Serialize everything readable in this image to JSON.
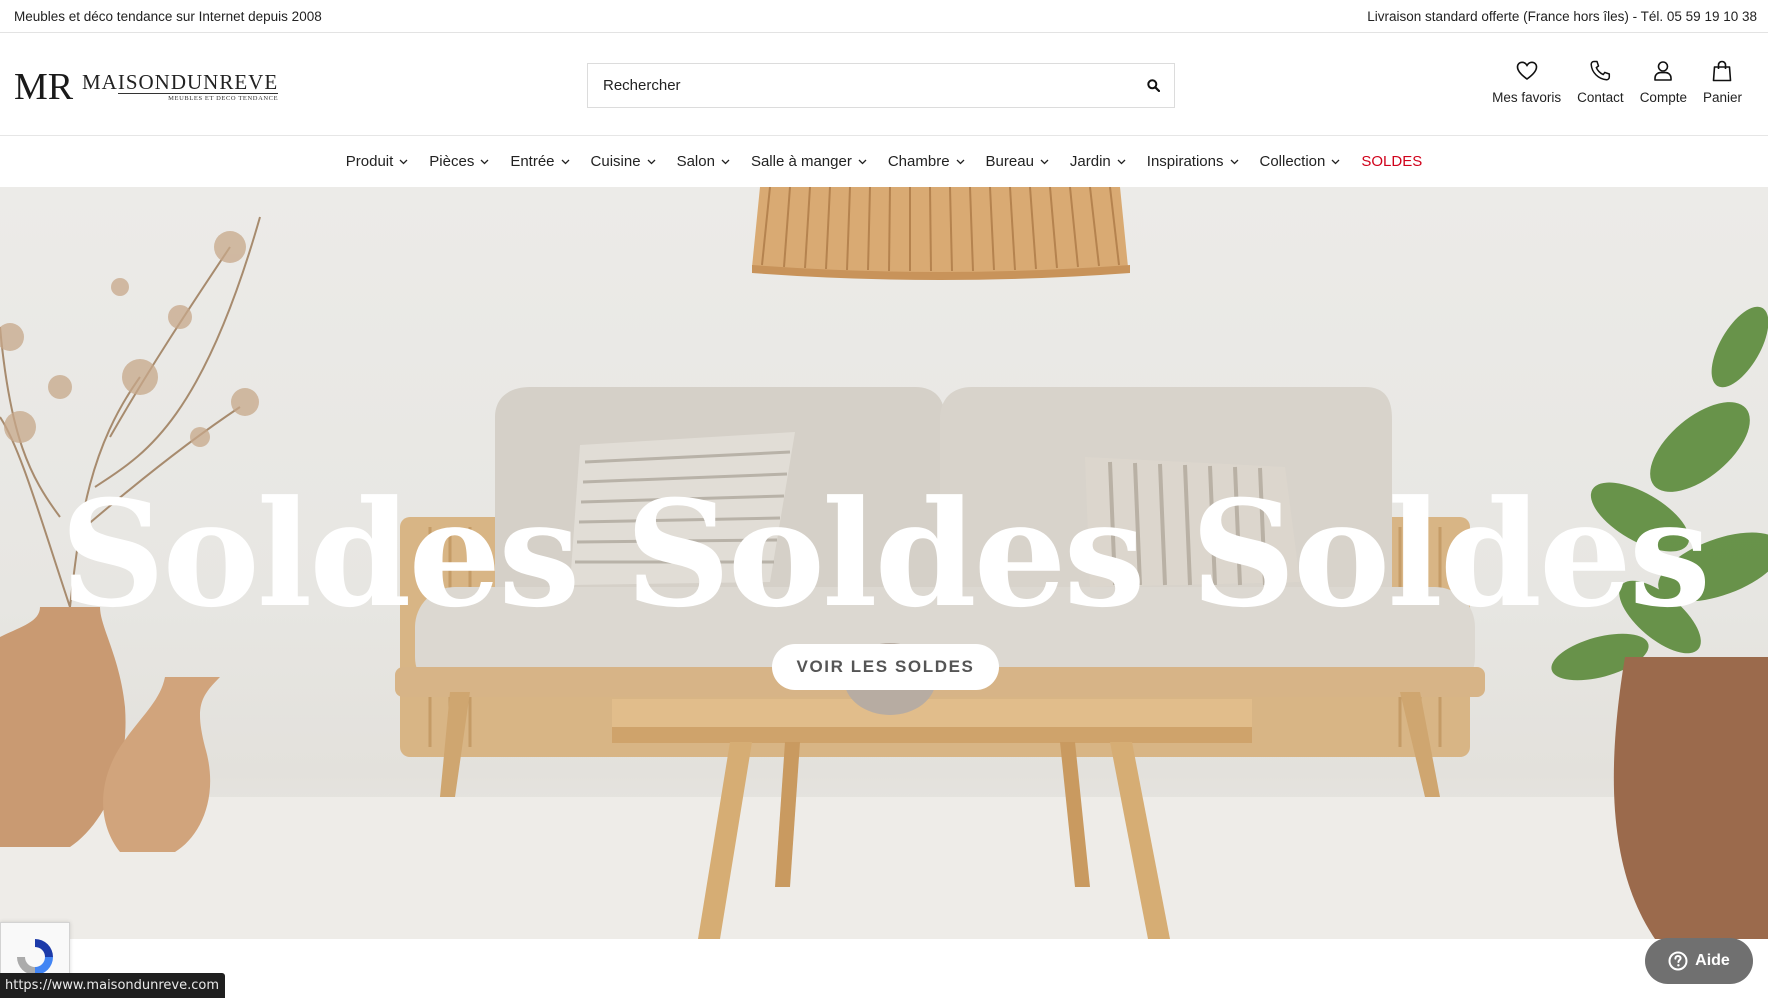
{
  "topbar": {
    "left_text": "Meubles et déco tendance sur Internet depuis 2008",
    "right_text": "Livraison standard offerte (France hors îles) - Tél. 05 59 19 10 38"
  },
  "logo": {
    "mark": "MR",
    "name": "MAISONDUNREVE",
    "tagline": "MEUBLES ET DECO TENDANCE"
  },
  "search": {
    "placeholder": "Rechercher",
    "icon": "search-icon"
  },
  "header_icons": [
    {
      "label": "Mes favoris",
      "icon": "heart-icon"
    },
    {
      "label": "Contact",
      "icon": "phone-icon"
    },
    {
      "label": "Compte",
      "icon": "user-icon"
    },
    {
      "label": "Panier",
      "icon": "bag-icon"
    }
  ],
  "nav": {
    "items": [
      {
        "label": "Produit",
        "has_dropdown": true
      },
      {
        "label": "Pièces",
        "has_dropdown": true
      },
      {
        "label": "Entrée",
        "has_dropdown": true
      },
      {
        "label": "Cuisine",
        "has_dropdown": true
      },
      {
        "label": "Salon",
        "has_dropdown": true
      },
      {
        "label": "Salle à manger",
        "has_dropdown": true
      },
      {
        "label": "Chambre",
        "has_dropdown": true
      },
      {
        "label": "Bureau",
        "has_dropdown": true
      },
      {
        "label": "Jardin",
        "has_dropdown": true
      },
      {
        "label": "Inspirations",
        "has_dropdown": true
      },
      {
        "label": "Collection",
        "has_dropdown": true
      },
      {
        "label": "SOLDES",
        "has_dropdown": false
      }
    ],
    "sale_color": "#d0021b"
  },
  "hero": {
    "title": "Soldes Soldes Soldes",
    "cta_label": "VOIR LES SOLDES"
  },
  "status_url": "https://www.maisondunreve.com",
  "help_widget": {
    "label": "Aide",
    "icon": "question-icon"
  },
  "recaptcha_icon": "recaptcha-icon"
}
